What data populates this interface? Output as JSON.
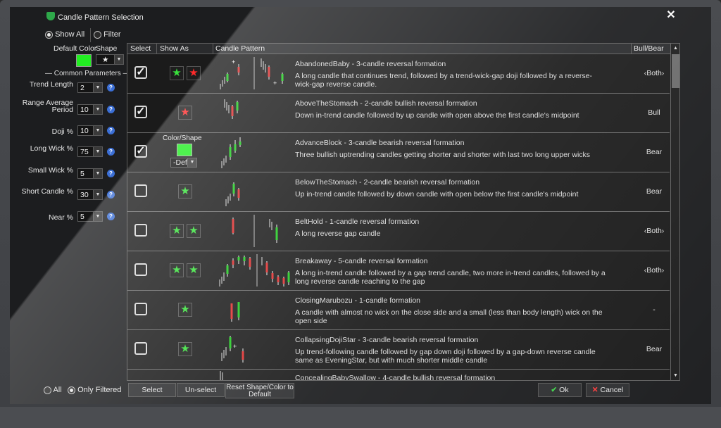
{
  "window": {
    "title": "Candle Pattern Selection",
    "close_glyph": "✕"
  },
  "filter": {
    "show_all": "Show All",
    "filter": "Filter",
    "show_all_selected": true
  },
  "defaults": {
    "color_label": "Default Color",
    "shape_label": "Shape",
    "shape_value": "★",
    "color": "#22ee22"
  },
  "common_params": {
    "heading": "— Common Parameters —",
    "items": [
      {
        "label": "Trend Length",
        "value": "2"
      },
      {
        "label": "Range Average Period",
        "value": "10"
      },
      {
        "label": "Doji %",
        "value": "10"
      },
      {
        "label": "Long Wick %",
        "value": "75"
      },
      {
        "label": "Small Wick %",
        "value": "5"
      },
      {
        "label": "Short Candle %",
        "value": "30"
      },
      {
        "label": "Near %",
        "value": "5"
      }
    ]
  },
  "table": {
    "headers": {
      "select": "Select",
      "show_as": "Show As",
      "pattern": "Candle Pattern",
      "bias": "Bull/Bear"
    },
    "rows": [
      {
        "name": "AbandonedBaby - 3-candle reversal formation",
        "desc": "A long candle that continues trend, followed by a trend-wick-gap doji followed by a reverse-wick-gap reverse candle.",
        "bias": "Both",
        "checked": true,
        "stars": [
          "green",
          "red"
        ]
      },
      {
        "name": "AboveTheStomach - 2-candle bullish reversal formation",
        "desc": "Down in-trend candle followed by up candle with open above the first candle's midpoint",
        "bias": "Bull",
        "checked": true,
        "stars": [
          "red"
        ]
      },
      {
        "name": "AdvanceBlock - 3-candle bearish reversal formation",
        "desc": "Three bullish uptrending candles getting shorter and shorter with last two long upper wicks",
        "bias": "Bear",
        "checked": true,
        "stars": [],
        "custom": {
          "label": "Color/Shape",
          "shape": "-Def-"
        }
      },
      {
        "name": "BelowTheStomach - 2-candle bearish reversal formation",
        "desc": "Up in-trend candle followed by down candle with open below the first candle's midpoint",
        "bias": "Bear",
        "checked": false,
        "stars": [
          "green"
        ]
      },
      {
        "name": "BeltHold - 1-candle reversal formation",
        "desc": "A long reverse gap candle",
        "bias": "Both",
        "checked": false,
        "stars": [
          "green",
          "green"
        ]
      },
      {
        "name": "Breakaway - 5-candle reversal formation",
        "desc": "A long in-trend candle followed by a gap trend candle, two more in-trend candles, followed by a long reverse candle reaching to the gap",
        "bias": "Both",
        "checked": false,
        "stars": [
          "green",
          "green"
        ]
      },
      {
        "name": "ClosingMarubozu - 1-candle formation",
        "desc": "A candle with almost no wick on the close side and a small (less than body length) wick on the open side",
        "bias": "-",
        "checked": false,
        "stars": [
          "green"
        ]
      },
      {
        "name": "CollapsingDojiStar - 3-candle bearish reversal formation",
        "desc": "Up trend-following candle followed by gap down doji followed by a gap-down reverse candle same as EveningStar, but with much shorter middle candle",
        "bias": "Bear",
        "checked": false,
        "stars": [
          "green"
        ]
      },
      {
        "name": "ConcealingBabySwallow - 4-candle bullish reversal formation",
        "desc": "",
        "bias": "",
        "checked": false,
        "stars": []
      }
    ]
  },
  "footer": {
    "all": "All",
    "only_filtered": "Only Filtered",
    "select": "Select",
    "unselect": "Un-select",
    "reset": "Reset Shape/Color to Default",
    "ok": "Ok",
    "cancel": "Cancel"
  }
}
